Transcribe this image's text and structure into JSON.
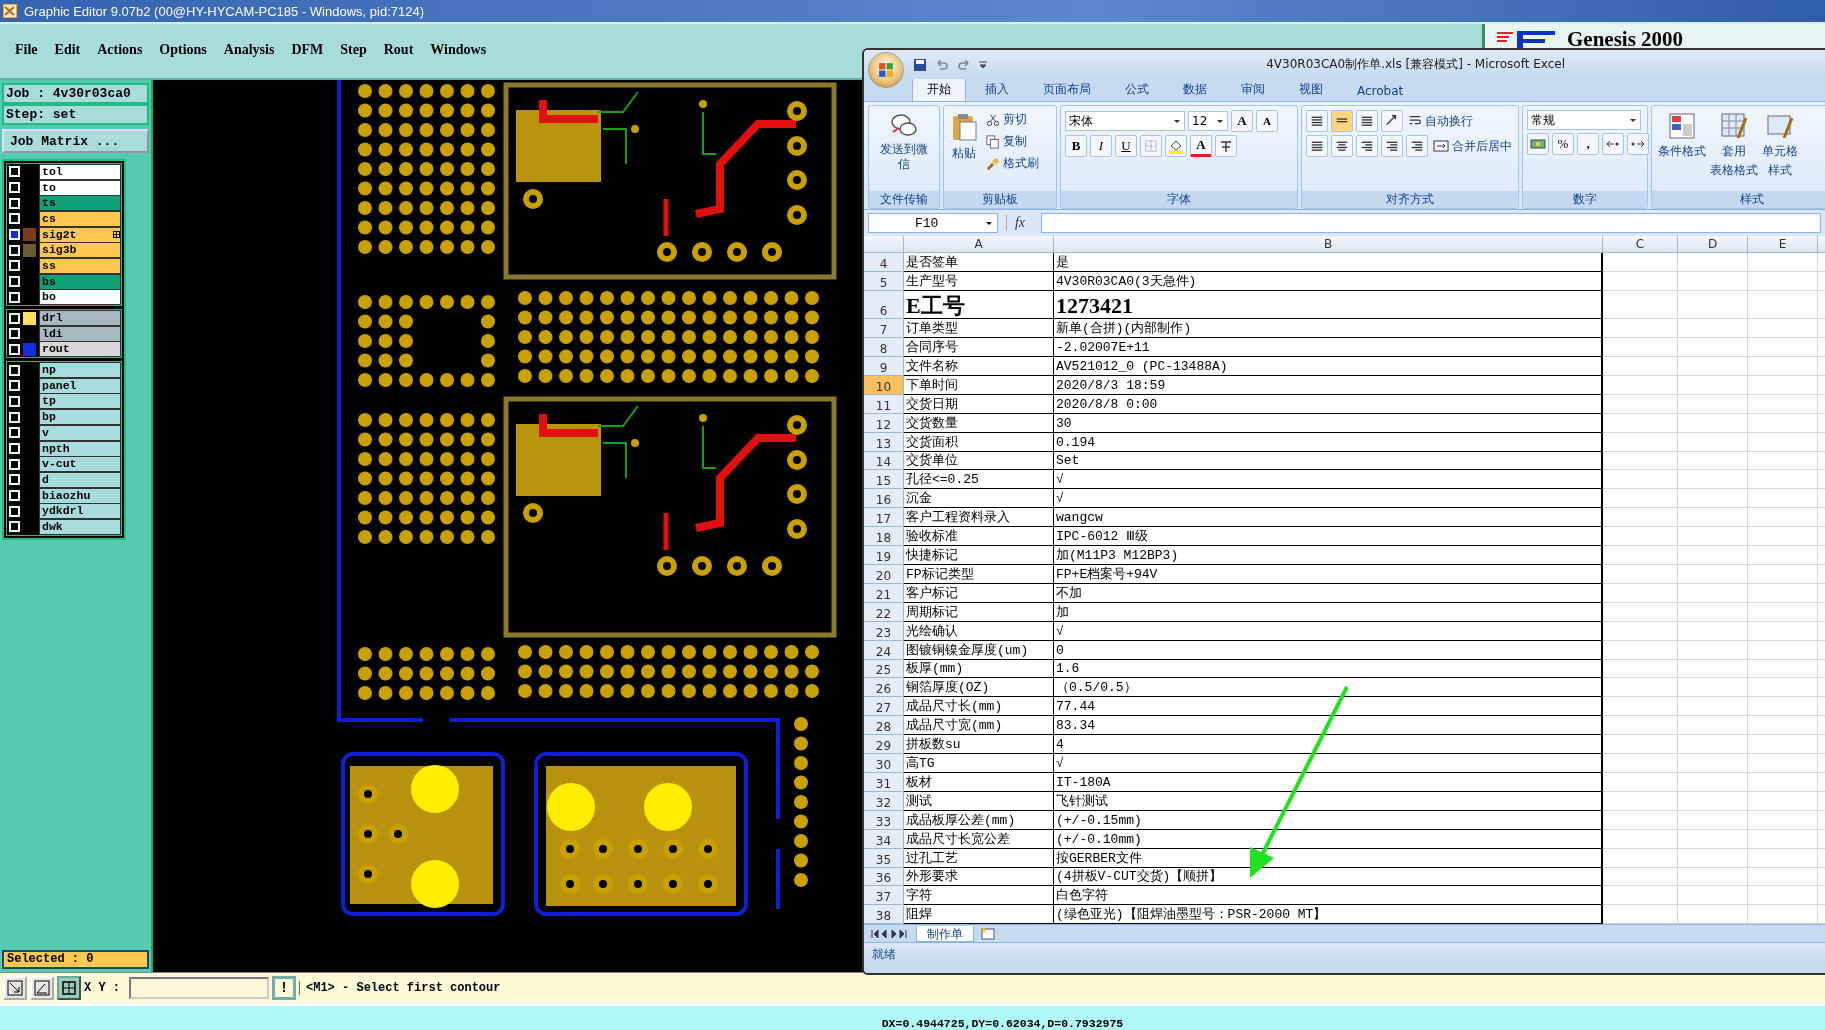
{
  "app": {
    "title": "Graphic Editor 9.07b2 (00@HY-HYCAM-PC185 - Windows, pid:7124)",
    "menu": [
      "File",
      "Edit",
      "Actions",
      "Options",
      "Analysis",
      "DFM",
      "Step",
      "Rout",
      "Windows"
    ],
    "brand": "Genesis 2000",
    "job": "Job  :  4v30r03ca0",
    "step": "Step:  set",
    "job_matrix_button": "Job Matrix ...",
    "layer_groups": [
      [
        {
          "name": "tol",
          "color": "#ffffff",
          "selected": false
        },
        {
          "name": "to",
          "color": "#ffffff",
          "selected": false
        },
        {
          "name": "ts",
          "color": "#12a078",
          "selected": false
        },
        {
          "name": "cs",
          "color": "#ffc850",
          "selected": false
        },
        {
          "name": "sig2t",
          "color": "#ffc850",
          "swatch": {
            "color": "#7a3a20"
          },
          "selected": true
        },
        {
          "name": "sig3b",
          "color": "#ffc850",
          "swatch": {
            "color": "#6e5a30"
          },
          "selected": false
        },
        {
          "name": "ss",
          "color": "#ffc850",
          "selected": false
        },
        {
          "name": "bs",
          "color": "#12a078",
          "selected": false
        },
        {
          "name": "bo",
          "color": "#ffffff",
          "selected": false
        }
      ],
      [
        {
          "name": "drl",
          "color": "#a8b8c0",
          "swatch": {
            "color": "#ffe060"
          },
          "selected": false
        },
        {
          "name": "ldi",
          "color": "#a8b8c0",
          "selected": false
        },
        {
          "name": "rout",
          "color": "#d8d8dc",
          "swatch": {
            "color": "#1030e0"
          },
          "selected": false
        }
      ],
      [
        {
          "name": "np",
          "color": "#a8dcdc",
          "selected": false
        },
        {
          "name": "panel",
          "color": "#a8dcdc",
          "selected": false
        },
        {
          "name": "tp",
          "color": "#a8dcdc",
          "selected": false
        },
        {
          "name": "bp",
          "color": "#a8dcdc",
          "selected": false
        },
        {
          "name": "v",
          "color": "#a8dcdc",
          "selected": false
        },
        {
          "name": "npth",
          "color": "#a8dcdc",
          "selected": false
        },
        {
          "name": "v-cut",
          "color": "#a8dcdc",
          "selected": false
        },
        {
          "name": "d",
          "color": "#a8dcdc",
          "selected": false
        },
        {
          "name": "biaozhu",
          "color": "#a8dcdc",
          "selected": false
        },
        {
          "name": "ydkdrl",
          "color": "#a8dcdc",
          "selected": false
        },
        {
          "name": "dwk",
          "color": "#a8dcdc",
          "selected": false
        }
      ]
    ],
    "selected_count": "Selected : 0",
    "xy_label": "X Y :",
    "alert_button": "!",
    "prompt": "<M1> - Select first contour",
    "status": "DX=0.4944725,DY=0.62034,D=0.7932975"
  },
  "excel": {
    "title": "4V30R03CA0制作单.xls  [兼容模式] - Microsoft Excel",
    "tabs": [
      {
        "label": "开始",
        "selected": true
      },
      {
        "label": "插入",
        "selected": false
      },
      {
        "label": "页面布局",
        "selected": false
      },
      {
        "label": "公式",
        "selected": false
      },
      {
        "label": "数据",
        "selected": false
      },
      {
        "label": "审阅",
        "selected": false
      },
      {
        "label": "视图",
        "selected": false
      },
      {
        "label": "Acrobat",
        "selected": false
      }
    ],
    "ribbon": {
      "share": {
        "button": "发送到微信",
        "label": "文件传输"
      },
      "clipboard": {
        "paste": "粘贴",
        "cut": "剪切",
        "copy": "复制",
        "format_painter": "格式刷",
        "label": "剪贴板"
      },
      "font": {
        "name": "宋体",
        "size": "12",
        "grow": "A",
        "shrink": "A",
        "bold": "B",
        "italic": "I",
        "underline": "U",
        "font_color": "A",
        "label": "字体"
      },
      "alignment": {
        "wrap": "自动换行",
        "merge": "合并后居中",
        "label": "对齐方式"
      },
      "number": {
        "format": "常规",
        "percent": "%",
        "comma": ",",
        "label": "数字"
      },
      "styles": {
        "conditional": "条件格式",
        "table_format_1": "套用",
        "table_format_2": "表格格式",
        "cell_style_1": "单元格",
        "cell_style_2": "样式",
        "label": "样式"
      }
    },
    "name_box": "F10",
    "fx": "fx",
    "columns": [
      "A",
      "B",
      "C",
      "D",
      "E"
    ],
    "rows": [
      {
        "n": "4",
        "a": "是否签单",
        "b": "是",
        "kind": "normal",
        "selected": false
      },
      {
        "n": "5",
        "a": "生产型号",
        "b": "4V30R03CA0(3天急件)",
        "kind": "normal",
        "selected": false
      },
      {
        "n": "6",
        "a": "E工号",
        "b": "1273421",
        "kind": "tall",
        "selected": false
      },
      {
        "n": "7",
        "a": "订单类型",
        "b": "新单(合拼)(内部制作)",
        "kind": "normal",
        "selected": false
      },
      {
        "n": "8",
        "a": "合同序号",
        "b": "-2.02007E+11",
        "kind": "normal",
        "selected": false
      },
      {
        "n": "9",
        "a": "文件名称",
        "b": "AV521012_0 (PC-13488A)",
        "kind": "normal",
        "selected": false
      },
      {
        "n": "10",
        "a": "下单时间",
        "b": "2020/8/3 18:59",
        "kind": "normal",
        "selected": true
      },
      {
        "n": "11",
        "a": "交货日期",
        "b": "2020/8/8 0:00",
        "kind": "normal",
        "selected": false
      },
      {
        "n": "12",
        "a": "交货数量",
        "b": "30",
        "kind": "normal",
        "selected": false
      },
      {
        "n": "13",
        "a": "交货面积",
        "b": "0.194",
        "kind": "normal",
        "selected": false
      },
      {
        "n": "14",
        "a": "交货单位",
        "b": "Set",
        "kind": "normal",
        "selected": false
      },
      {
        "n": "15",
        "a": "孔径<=0.25",
        "b": "√",
        "kind": "normal",
        "selected": false
      },
      {
        "n": "16",
        "a": "沉金",
        "b": "√",
        "kind": "normal",
        "selected": false
      },
      {
        "n": "17",
        "a": "客户工程资料录入",
        "b": "wangcw",
        "kind": "normal",
        "selected": false
      },
      {
        "n": "18",
        "a": "验收标准",
        "b": "IPC-6012 Ⅲ级",
        "kind": "normal",
        "selected": false
      },
      {
        "n": "19",
        "a": "快捷标记",
        "b": "加(M11P3 M12BP3)",
        "kind": "normal",
        "selected": false
      },
      {
        "n": "20",
        "a": "FP标记类型",
        "b": "FP+E档案号+94V",
        "kind": "normal",
        "selected": false
      },
      {
        "n": "21",
        "a": "客户标记",
        "b": "不加",
        "kind": "normal",
        "selected": false
      },
      {
        "n": "22",
        "a": "周期标记",
        "b": "加",
        "kind": "normal",
        "selected": false
      },
      {
        "n": "23",
        "a": "光绘确认",
        "b": "√",
        "kind": "normal",
        "selected": false
      },
      {
        "n": "24",
        "a": "图镀铜镍金厚度(um)",
        "b": "0",
        "kind": "normal",
        "selected": false
      },
      {
        "n": "25",
        "a": "板厚(mm)",
        "b": "1.6",
        "kind": "normal",
        "selected": false
      },
      {
        "n": "26",
        "a": "铜箔厚度(OZ)",
        "b": "（0.5/0.5）",
        "kind": "normal",
        "selected": false
      },
      {
        "n": "27",
        "a": "成品尺寸长(mm)",
        "b": "77.44",
        "kind": "normal",
        "selected": false
      },
      {
        "n": "28",
        "a": "成品尺寸宽(mm)",
        "b": "83.34",
        "kind": "normal",
        "selected": false
      },
      {
        "n": "29",
        "a": "拼板数su",
        "b": "4",
        "kind": "normal",
        "selected": false
      },
      {
        "n": "30",
        "a": "高TG",
        "b": "√",
        "kind": "normal",
        "selected": false
      },
      {
        "n": "31",
        "a": "板材",
        "b": "IT-180A",
        "kind": "normal",
        "selected": false
      },
      {
        "n": "32",
        "a": "测试",
        "b": "飞针测试",
        "kind": "normal",
        "selected": false
      },
      {
        "n": "33",
        "a": "成品板厚公差(mm)",
        "b": "(+/-0.15mm)",
        "kind": "normal",
        "selected": false
      },
      {
        "n": "34",
        "a": "成品尺寸长宽公差",
        "b": "(+/-0.10mm)",
        "kind": "normal",
        "selected": false
      },
      {
        "n": "35",
        "a": "过孔工艺",
        "b": "按GERBER文件",
        "kind": "normal",
        "selected": false
      },
      {
        "n": "36",
        "a": "外形要求",
        "b": "(4拼板V-CUT交货)【顺拼】",
        "kind": "normal",
        "selected": false
      },
      {
        "n": "37",
        "a": "字符",
        "b": "白色字符",
        "kind": "normal",
        "selected": false
      },
      {
        "n": "38",
        "a": "阻焊",
        "b": "(绿色亚光)【阻焊油墨型号：PSR-2000 MT】",
        "kind": "normal",
        "selected": false
      }
    ],
    "sheet_tab": "制作单",
    "status": "就绪"
  }
}
